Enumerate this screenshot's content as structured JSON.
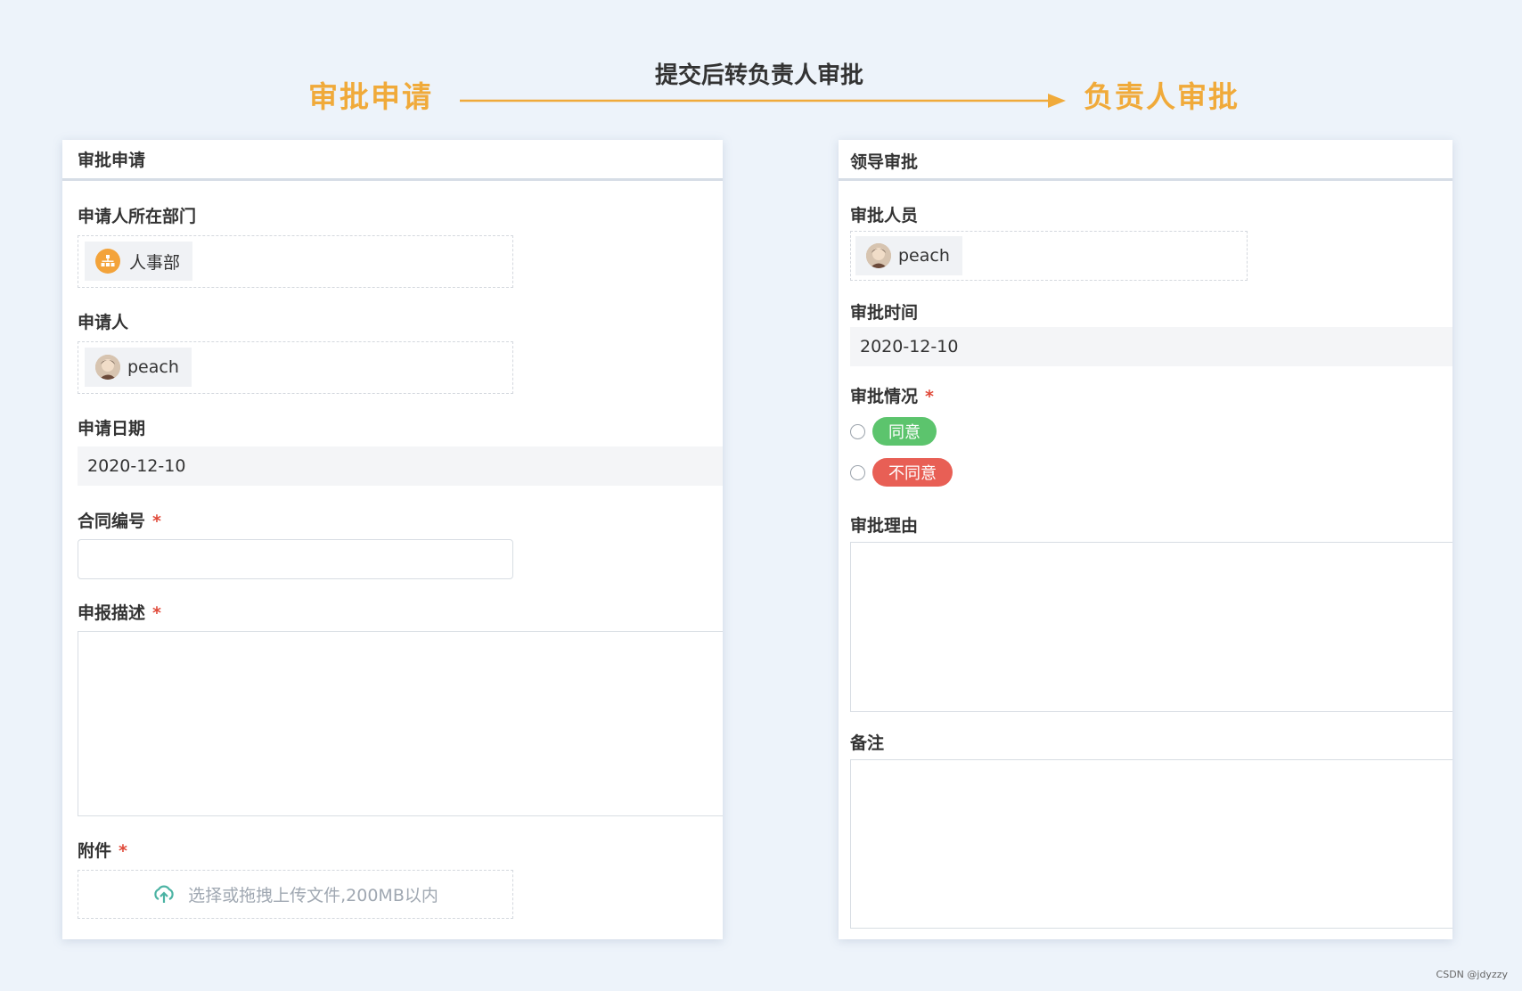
{
  "flow": {
    "left_label": "审批申请",
    "arrow_label": "提交后转负责人审批",
    "right_label": "负责人审批",
    "accent_color": "#f0aa3a"
  },
  "left_panel": {
    "title": "审批申请",
    "dept": {
      "label": "申请人所在部门",
      "value": "人事部",
      "icon": "org-chart-icon"
    },
    "applicant": {
      "label": "申请人",
      "value": "peach",
      "icon": "avatar"
    },
    "date": {
      "label": "申请日期",
      "value": "2020-12-10"
    },
    "contract": {
      "label": "合同编号",
      "required": "*",
      "value": ""
    },
    "description": {
      "label": "申报描述",
      "required": "*",
      "value": ""
    },
    "attachment": {
      "label": "附件",
      "required": "*",
      "placeholder": "选择或拖拽上传文件,200MB以内",
      "icon": "cloud-upload-icon"
    }
  },
  "right_panel": {
    "title": "领导审批",
    "approver": {
      "label": "审批人员",
      "value": "peach",
      "icon": "avatar"
    },
    "approve_time": {
      "label": "审批时间",
      "value": "2020-12-10"
    },
    "status": {
      "label": "审批情况",
      "required": "*",
      "options": [
        "同意",
        "不同意"
      ],
      "colors": [
        "#5cc46d",
        "#e85f55"
      ]
    },
    "reason": {
      "label": "审批理由",
      "value": ""
    },
    "remark": {
      "label": "备注",
      "value": ""
    }
  },
  "watermark": "CSDN @jdyzzy"
}
